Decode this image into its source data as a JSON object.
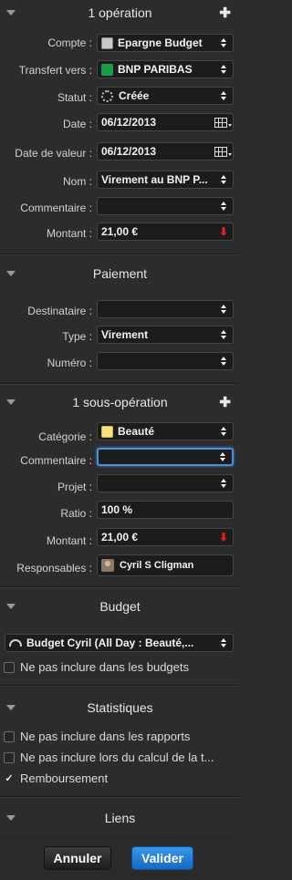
{
  "operation": {
    "header": "1 opération",
    "fields": {
      "compte": {
        "label": "Compte :",
        "value": "Epargne Budget"
      },
      "transfert": {
        "label": "Transfert vers :",
        "value": "BNP PARIBAS"
      },
      "statut": {
        "label": "Statut :",
        "value": "Créée"
      },
      "date": {
        "label": "Date :",
        "value": "06/12/2013"
      },
      "date_valeur": {
        "label": "Date de valeur :",
        "value": "06/12/2013"
      },
      "nom": {
        "label": "Nom :",
        "value": "Virement au BNP P..."
      },
      "commentaire": {
        "label": "Commentaire :",
        "value": ""
      },
      "montant": {
        "label": "Montant :",
        "value": "21,00 €"
      }
    }
  },
  "paiement": {
    "header": "Paiement",
    "fields": {
      "destinataire": {
        "label": "Destinataire :",
        "value": ""
      },
      "type": {
        "label": "Type :",
        "value": "Virement"
      },
      "numero": {
        "label": "Numéro :",
        "value": ""
      }
    }
  },
  "sous_operation": {
    "header": "1 sous-opération",
    "fields": {
      "categorie": {
        "label": "Catégorie :",
        "value": "Beauté"
      },
      "commentaire": {
        "label": "Commentaire :",
        "value": ""
      },
      "projet": {
        "label": "Projet :",
        "value": ""
      },
      "ratio": {
        "label": "Ratio :",
        "value": "100 %"
      },
      "montant": {
        "label": "Montant :",
        "value": "21,00 €"
      },
      "responsables": {
        "label": "Responsables :",
        "value": "Cyril S Cligman"
      }
    }
  },
  "budget": {
    "header": "Budget",
    "select_value": "Budget Cyril (All Day : Beauté,...",
    "checkbox_label": "Ne pas inclure dans les budgets"
  },
  "statistiques": {
    "header": "Statistiques",
    "checkboxes": [
      {
        "label": "Ne pas inclure dans les rapports",
        "checked": false
      },
      {
        "label": "Ne pas inclure lors du calcul de la t...",
        "checked": false
      },
      {
        "label": "Remboursement",
        "checked": true
      }
    ]
  },
  "liens": {
    "header": "Liens"
  },
  "footer": {
    "cancel": "Annuler",
    "validate": "Valider"
  },
  "colors": {
    "background": "#2c2c2c",
    "accent": "#1a7fd4",
    "category_swatch": "#f6e27a",
    "negative_arrow": "#e02020"
  },
  "icons": {
    "account": "bank-card-icon",
    "transfer": "bnp-logo-icon",
    "status": "spinner-icon",
    "date": "calendar-icon",
    "amount_sign": "red-down-arrow-icon",
    "budget": "gauge-icon"
  }
}
